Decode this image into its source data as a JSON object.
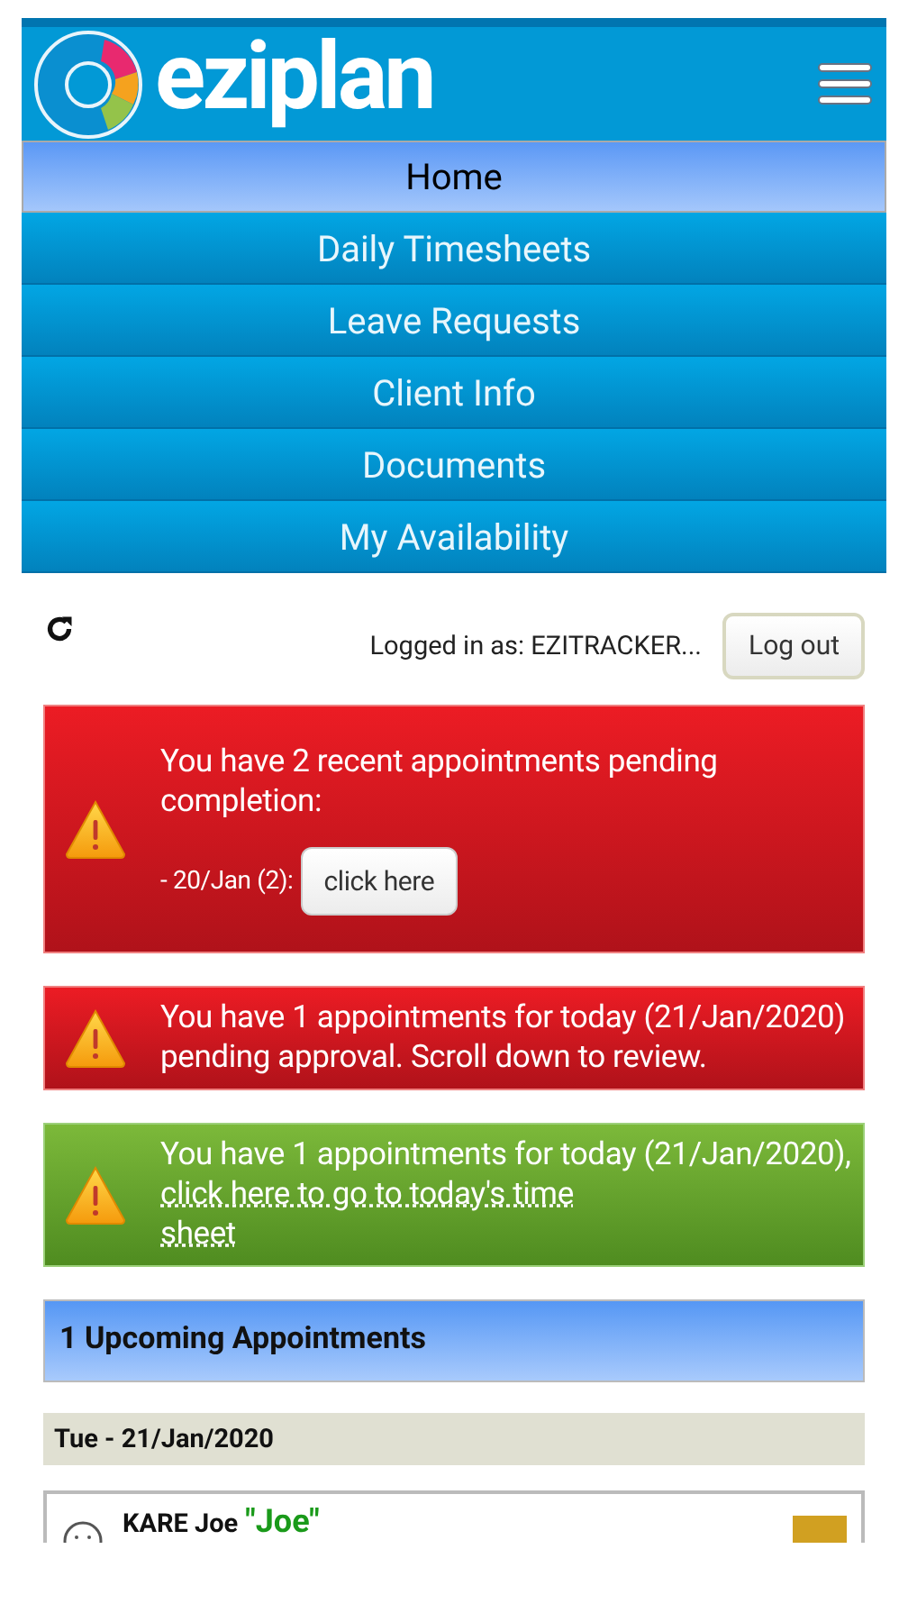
{
  "header": {
    "logo_text": "eziplan"
  },
  "nav": [
    {
      "label": "Home",
      "selected": true
    },
    {
      "label": "Daily Timesheets",
      "selected": false
    },
    {
      "label": "Leave Requests",
      "selected": false
    },
    {
      "label": "Client Info",
      "selected": false
    },
    {
      "label": "Documents",
      "selected": false
    },
    {
      "label": "My Availability",
      "selected": false
    }
  ],
  "user_bar": {
    "logged_in_text": "Logged in as: EZITRACKER...",
    "logout_button": "Log out"
  },
  "alerts": [
    {
      "kind": "danger",
      "text": "You have 2 recent appointments pending completion:",
      "items": [
        {
          "label": "- 20/Jan (2):",
          "button": "click here"
        }
      ]
    },
    {
      "kind": "danger",
      "text": "You have 1 appointments for today (21/Jan/2020) pending approval. Scroll down to review."
    },
    {
      "kind": "success",
      "text": "You have 1 appointments for today (21/Jan/2020),",
      "link_lines": [
        "click here to go to today's time",
        "sheet"
      ]
    }
  ],
  "upcoming": {
    "title": "1 Upcoming Appointments"
  },
  "day": {
    "date": "Tue - 21/Jan/2020"
  },
  "appointment": {
    "client": "KARE Joe",
    "nickname": "\"Joe\""
  }
}
